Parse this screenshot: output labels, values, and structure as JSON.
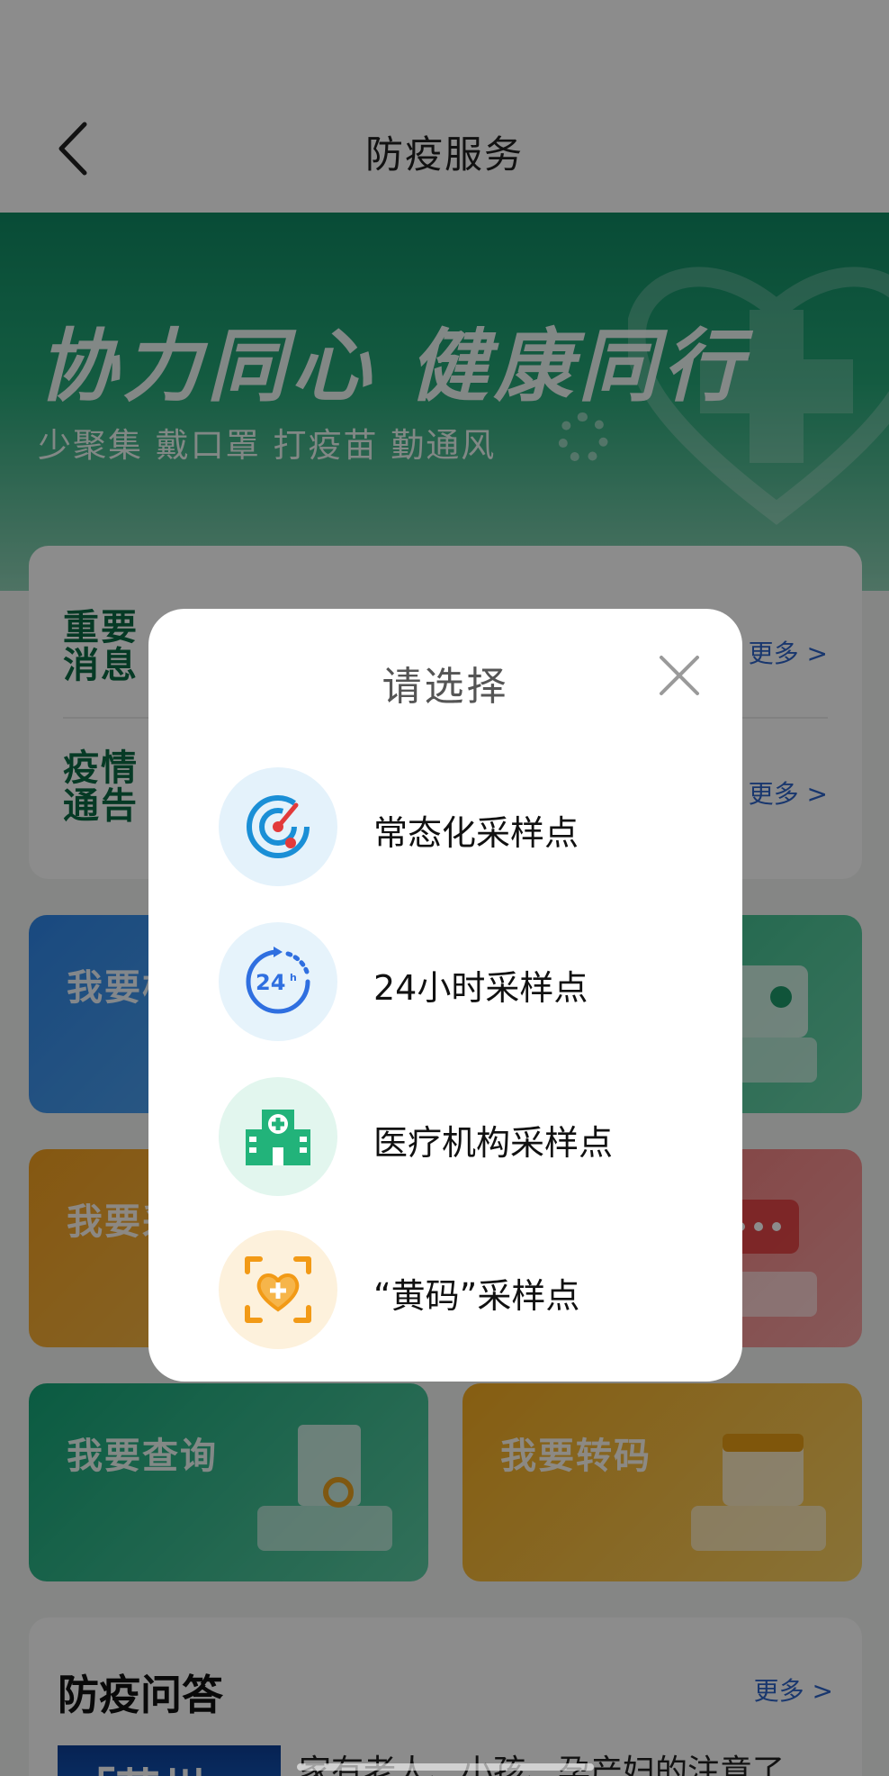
{
  "header": {
    "title": "防疫服务",
    "back_icon": "chevron-left-icon"
  },
  "banner": {
    "slogan": "协力同心 健康同行",
    "subtitle": "少聚集 戴口罩 打疫苗 勤通风"
  },
  "notices": [
    {
      "badge": "重要消息",
      "more": "更多 >"
    },
    {
      "badge": "疫情通告",
      "more": "更多 >"
    }
  ],
  "tiles": [
    {
      "label": "我要核"
    },
    {
      "label": ""
    },
    {
      "label": "我要采"
    },
    {
      "label": ""
    },
    {
      "label": "我要查询"
    },
    {
      "label": "我要转码"
    }
  ],
  "qa": {
    "title": "防疫问答",
    "more": "更多 >",
    "thumb_text": "「苏州",
    "headline": "家有老人、小孩、孕产妇的注意了"
  },
  "modal": {
    "title": "请选择",
    "close_icon": "close-icon",
    "options": [
      {
        "label": "常态化采样点",
        "icon": "radar-icon",
        "color": "#1a8fd6"
      },
      {
        "label": "24小时采样点",
        "icon": "24h-clock-icon",
        "color": "#2f6fe0"
      },
      {
        "label": "医疗机构采样点",
        "icon": "hospital-icon",
        "color": "#22b37a"
      },
      {
        "label": "“黄码”采样点",
        "icon": "heart-scan-icon",
        "color": "#f29a16"
      }
    ]
  }
}
